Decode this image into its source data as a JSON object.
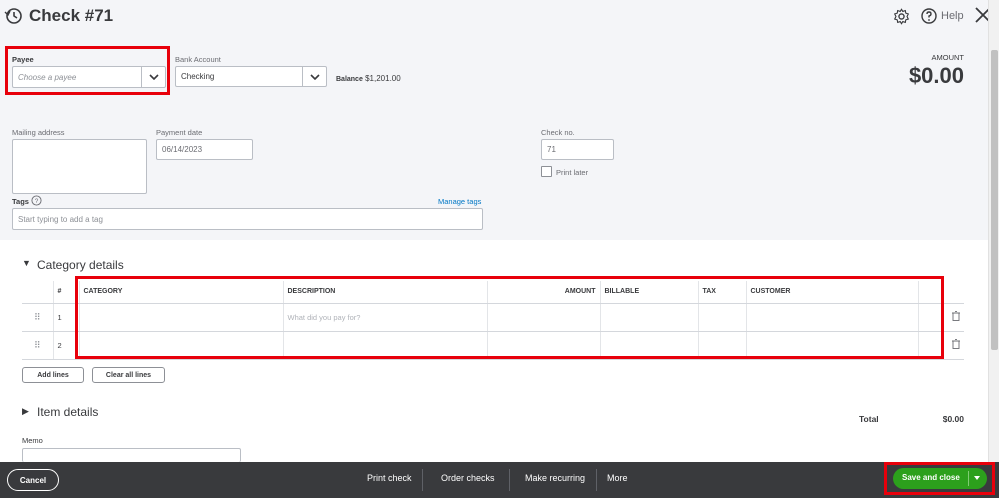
{
  "header": {
    "title": "Check #71",
    "help_label": "Help"
  },
  "form": {
    "payee": {
      "label": "Payee",
      "placeholder": "Choose a payee"
    },
    "bank_account": {
      "label": "Bank Account",
      "value": "Checking"
    },
    "balance": {
      "label": "Balance",
      "value": "$1,201.00"
    },
    "amount": {
      "label": "AMOUNT",
      "value": "$0.00"
    },
    "mailing_address": {
      "label": "Mailing address"
    },
    "payment_date": {
      "label": "Payment date",
      "value": "06/14/2023"
    },
    "check_no": {
      "label": "Check no.",
      "value": "71"
    },
    "print_later": {
      "label": "Print later",
      "checked": false
    },
    "tags": {
      "label": "Tags",
      "placeholder": "Start typing to add a tag",
      "manage_label": "Manage tags"
    }
  },
  "category_details": {
    "title": "Category details",
    "columns": [
      "#",
      "CATEGORY",
      "DESCRIPTION",
      "AMOUNT",
      "BILLABLE",
      "TAX",
      "CUSTOMER"
    ],
    "rows": [
      {
        "num": "1",
        "category": "",
        "description_placeholder": "What did you pay for?",
        "amount": "",
        "billable": "",
        "tax": "",
        "customer": ""
      },
      {
        "num": "2",
        "category": "",
        "description_placeholder": "",
        "amount": "",
        "billable": "",
        "tax": "",
        "customer": ""
      }
    ],
    "add_lines_label": "Add lines",
    "clear_all_label": "Clear all lines"
  },
  "item_details": {
    "title": "Item details"
  },
  "memo": {
    "label": "Memo"
  },
  "totals": {
    "label": "Total",
    "value": "$0.00"
  },
  "footer": {
    "cancel_label": "Cancel",
    "print_check_label": "Print check",
    "order_checks_label": "Order checks",
    "make_recurring_label": "Make recurring",
    "more_label": "More",
    "save_label": "Save and close"
  },
  "colors": {
    "highlight": "#e8000b",
    "save_green": "#2ca01c",
    "footer_bg": "#393a3d",
    "header_bg": "#f4f5f8",
    "link_blue": "#0077c5"
  }
}
